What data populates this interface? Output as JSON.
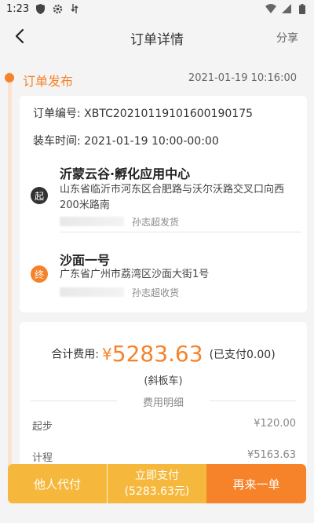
{
  "statusbar": {
    "time": "1:23",
    "left_icons": [
      "shield-icon",
      "gear-icon",
      "data-transfer-icon"
    ],
    "right_icons": [
      "wifi-icon",
      "signal-icon",
      "battery-icon"
    ]
  },
  "header": {
    "title": "订单详情",
    "share_label": "分享",
    "back_icon": "back-arrow-icon"
  },
  "status": {
    "label": "订单发布",
    "time": "2021-01-19 10:16:00"
  },
  "order": {
    "number_label": "订单编号:",
    "number_value": "XBTC20210119101600190175",
    "loading_label": "装车时间:",
    "loading_value": "2021-01-19 10:00-00:00"
  },
  "origin": {
    "badge": "起",
    "name": "沂蒙云谷·孵化应用中心",
    "address": "山东省临沂市河东区合肥路与沃尔沃路交叉口向西200米路南",
    "contact": "孙志超发货"
  },
  "destination": {
    "badge": "终",
    "name": "沙面一号",
    "address": "广东省广州市荔湾区沙面大街1号",
    "contact": "孙志超收货"
  },
  "payment": {
    "total_label": "合计费用:",
    "currency": "¥",
    "total_amount": "5283.63",
    "paid_text": "(已支付0.00)",
    "vehicle": "(斜板车)",
    "detail_title": "费用明细",
    "fees": [
      {
        "label": "起步",
        "value": "¥120.00"
      },
      {
        "label": "计程",
        "value": "¥5163.63"
      }
    ]
  },
  "actions": {
    "other_pay": "他人代付",
    "pay_now": "立即支付",
    "pay_now_amount": "(5283.63元)",
    "reorder": "再来一单"
  },
  "colors": {
    "accent": "#f6822a",
    "secondary_button": "#f5b83c"
  }
}
